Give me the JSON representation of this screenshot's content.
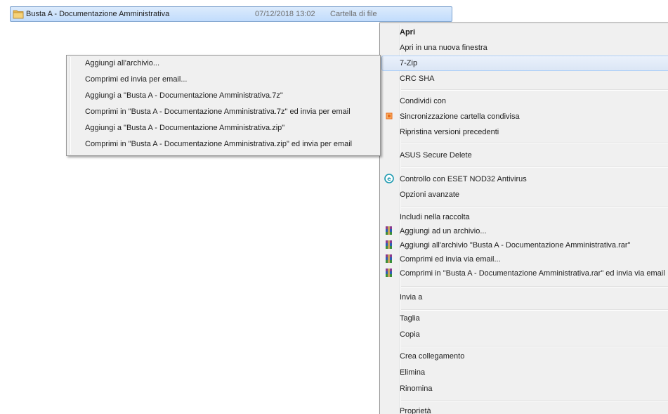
{
  "colors": {
    "menu_bg": "#f0f0f0",
    "selection_bg": "#cfe3fc",
    "hover_bg": "#dbe6f5",
    "folder_yellow": "#e8b74a",
    "eset_teal": "#1c9ab0",
    "sync_orange": "#e86a1b"
  },
  "file_row": {
    "name": "Busta A - Documentazione Amministrativa",
    "date": "07/12/2018 13:02",
    "type": "Cartella di file",
    "icon": "folder-icon"
  },
  "context_menu": {
    "items": [
      {
        "label": "Apri",
        "bold": true
      },
      {
        "label": "Apri in una nuova finestra"
      },
      {
        "label": "7-Zip",
        "highlighted": true,
        "has_submenu": true
      },
      {
        "label": "CRC SHA",
        "has_submenu": true
      },
      {
        "label": "Condividi con",
        "has_submenu": true
      },
      {
        "label": "Sincronizzazione cartella condivisa",
        "icon": "sync-icon"
      },
      {
        "label": "Ripristina versioni precedenti"
      },
      {
        "label": "ASUS Secure Delete"
      },
      {
        "label": "Controllo con ESET NOD32 Antivirus",
        "icon": "eset-icon"
      },
      {
        "label": "Opzioni avanzate",
        "has_submenu": true
      },
      {
        "label": "Includi nella raccolta",
        "has_submenu": true
      },
      {
        "label": "Aggiungi ad un archivio...",
        "icon": "winrar-icon"
      },
      {
        "label": "Aggiungi all'archivio \"Busta A - Documentazione Amministrativa.rar\"",
        "icon": "winrar-icon"
      },
      {
        "label": "Comprimi ed invia via email...",
        "icon": "winrar-icon"
      },
      {
        "label": "Comprimi in \"Busta A - Documentazione Amministrativa.rar\" ed invia via email",
        "icon": "winrar-icon"
      },
      {
        "label": "Invia a",
        "has_submenu": true
      },
      {
        "label": "Taglia"
      },
      {
        "label": "Copia"
      },
      {
        "label": "Crea collegamento"
      },
      {
        "label": "Elimina"
      },
      {
        "label": "Rinomina"
      },
      {
        "label": "Proprietà"
      }
    ]
  },
  "zip_submenu": {
    "items": [
      {
        "label": "Aggiungi all'archivio..."
      },
      {
        "label": "Comprimi ed invia per email..."
      },
      {
        "label": "Aggiungi a \"Busta A - Documentazione Amministrativa.7z\""
      },
      {
        "label": "Comprimi in \"Busta A - Documentazione Amministrativa.7z\" ed invia per email"
      },
      {
        "label": "Aggiungi a \"Busta A - Documentazione Amministrativa.zip\""
      },
      {
        "label": "Comprimi in \"Busta A - Documentazione Amministrativa.zip\" ed invia per email"
      }
    ]
  }
}
